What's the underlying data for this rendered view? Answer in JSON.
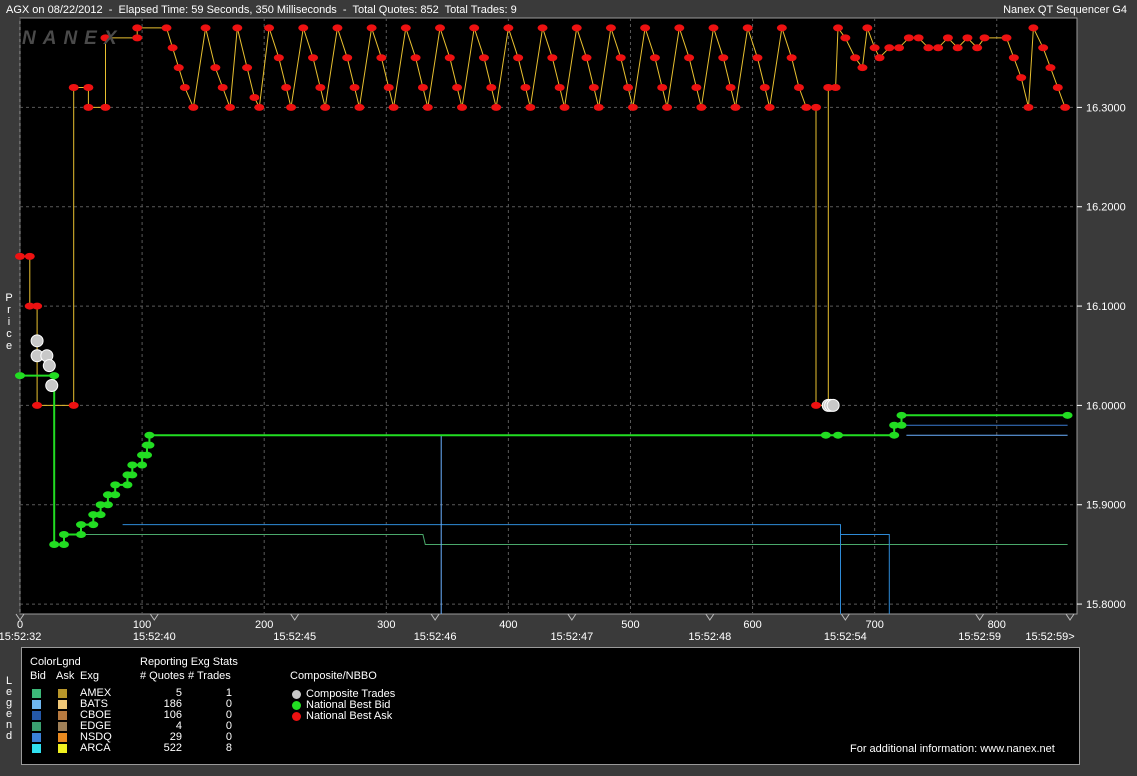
{
  "header": {
    "left_text": "AGX on 08/22/2012  -  Elapsed Time: 59 Seconds, 350 Milliseconds  -  Total Quotes: 852  Total Trades: 9",
    "right_text": "Nanex QT Sequencer G4",
    "watermark": "NANEX"
  },
  "axis": {
    "ylabel_letters": [
      "P",
      "r",
      "i",
      "c",
      "e"
    ],
    "legend_letters": [
      "L",
      "e",
      "g",
      "e",
      "n",
      "d"
    ]
  },
  "chart_data": {
    "type": "line",
    "ylim": [
      15.79,
      16.39
    ],
    "xlim": [
      0,
      860
    ],
    "y_ticks": [
      "15.8000",
      "15.9000",
      "16.0000",
      "16.1000",
      "16.2000",
      "16.3000"
    ],
    "x_ticks": [
      "0",
      "100",
      "200",
      "300",
      "400",
      "500",
      "600",
      "700",
      "800"
    ],
    "time_labels": [
      {
        "x": 0,
        "label": "15:52:32"
      },
      {
        "x": 110,
        "label": "15:52:40"
      },
      {
        "x": 225,
        "label": "15:52:45"
      },
      {
        "x": 340,
        "label": "15:52:46"
      },
      {
        "x": 452,
        "label": "15:52:47"
      },
      {
        "x": 565,
        "label": "15:52:48"
      },
      {
        "x": 676,
        "label": "15:52:54"
      },
      {
        "x": 786,
        "label": "15:52:59"
      },
      {
        "x": 860,
        "label": "15:52:59>"
      }
    ],
    "composite_trades": [
      {
        "x": 14,
        "y": 16.065
      },
      {
        "x": 14,
        "y": 16.05
      },
      {
        "x": 22,
        "y": 16.05
      },
      {
        "x": 24,
        "y": 16.04
      },
      {
        "x": 26,
        "y": 16.02
      },
      {
        "x": 662,
        "y": 16.0
      },
      {
        "x": 664,
        "y": 16.0
      },
      {
        "x": 666,
        "y": 16.0
      }
    ],
    "nbbo_bid": [
      {
        "x": 0,
        "y": 16.03
      },
      {
        "x": 28,
        "y": 16.03
      },
      {
        "x": 28,
        "y": 15.86
      },
      {
        "x": 36,
        "y": 15.86
      },
      {
        "x": 36,
        "y": 15.87
      },
      {
        "x": 50,
        "y": 15.87
      },
      {
        "x": 50,
        "y": 15.88
      },
      {
        "x": 60,
        "y": 15.88
      },
      {
        "x": 60,
        "y": 15.89
      },
      {
        "x": 66,
        "y": 15.89
      },
      {
        "x": 66,
        "y": 15.9
      },
      {
        "x": 72,
        "y": 15.9
      },
      {
        "x": 72,
        "y": 15.91
      },
      {
        "x": 78,
        "y": 15.91
      },
      {
        "x": 78,
        "y": 15.92
      },
      {
        "x": 88,
        "y": 15.92
      },
      {
        "x": 88,
        "y": 15.93
      },
      {
        "x": 92,
        "y": 15.93
      },
      {
        "x": 92,
        "y": 15.94
      },
      {
        "x": 100,
        "y": 15.94
      },
      {
        "x": 100,
        "y": 15.95
      },
      {
        "x": 104,
        "y": 15.95
      },
      {
        "x": 104,
        "y": 15.96
      },
      {
        "x": 106,
        "y": 15.96
      },
      {
        "x": 106,
        "y": 15.97
      },
      {
        "x": 660,
        "y": 15.97
      },
      {
        "x": 670,
        "y": 15.97
      },
      {
        "x": 716,
        "y": 15.97
      },
      {
        "x": 716,
        "y": 15.98
      },
      {
        "x": 722,
        "y": 15.98
      },
      {
        "x": 722,
        "y": 15.99
      },
      {
        "x": 858,
        "y": 15.99
      }
    ],
    "nbbo_ask": [
      {
        "x": 0,
        "y": 16.15
      },
      {
        "x": 8,
        "y": 16.15
      },
      {
        "x": 8,
        "y": 16.1
      },
      {
        "x": 14,
        "y": 16.1
      },
      {
        "x": 14,
        "y": 16.0
      },
      {
        "x": 44,
        "y": 16.0
      },
      {
        "x": 44,
        "y": 16.32
      },
      {
        "x": 56,
        "y": 16.32
      },
      {
        "x": 56,
        "y": 16.3
      },
      {
        "x": 70,
        "y": 16.3
      },
      {
        "x": 70,
        "y": 16.37
      },
      {
        "x": 96,
        "y": 16.37
      },
      {
        "x": 96,
        "y": 16.38
      },
      {
        "x": 120,
        "y": 16.38
      },
      {
        "x": 125,
        "y": 16.36
      },
      {
        "x": 130,
        "y": 16.34
      },
      {
        "x": 135,
        "y": 16.32
      },
      {
        "x": 142,
        "y": 16.3
      },
      {
        "x": 152,
        "y": 16.38
      },
      {
        "x": 160,
        "y": 16.34
      },
      {
        "x": 166,
        "y": 16.32
      },
      {
        "x": 172,
        "y": 16.3
      },
      {
        "x": 178,
        "y": 16.38
      },
      {
        "x": 186,
        "y": 16.34
      },
      {
        "x": 192,
        "y": 16.31
      },
      {
        "x": 196,
        "y": 16.3
      },
      {
        "x": 204,
        "y": 16.38
      },
      {
        "x": 212,
        "y": 16.35
      },
      {
        "x": 218,
        "y": 16.32
      },
      {
        "x": 222,
        "y": 16.3
      },
      {
        "x": 232,
        "y": 16.38
      },
      {
        "x": 240,
        "y": 16.35
      },
      {
        "x": 246,
        "y": 16.32
      },
      {
        "x": 250,
        "y": 16.3
      },
      {
        "x": 260,
        "y": 16.38
      },
      {
        "x": 268,
        "y": 16.35
      },
      {
        "x": 274,
        "y": 16.32
      },
      {
        "x": 278,
        "y": 16.3
      },
      {
        "x": 288,
        "y": 16.38
      },
      {
        "x": 296,
        "y": 16.35
      },
      {
        "x": 302,
        "y": 16.32
      },
      {
        "x": 306,
        "y": 16.3
      },
      {
        "x": 316,
        "y": 16.38
      },
      {
        "x": 324,
        "y": 16.35
      },
      {
        "x": 330,
        "y": 16.32
      },
      {
        "x": 334,
        "y": 16.3
      },
      {
        "x": 344,
        "y": 16.38
      },
      {
        "x": 352,
        "y": 16.35
      },
      {
        "x": 358,
        "y": 16.32
      },
      {
        "x": 362,
        "y": 16.3
      },
      {
        "x": 372,
        "y": 16.38
      },
      {
        "x": 380,
        "y": 16.35
      },
      {
        "x": 386,
        "y": 16.32
      },
      {
        "x": 390,
        "y": 16.3
      },
      {
        "x": 400,
        "y": 16.38
      },
      {
        "x": 408,
        "y": 16.35
      },
      {
        "x": 414,
        "y": 16.32
      },
      {
        "x": 418,
        "y": 16.3
      },
      {
        "x": 428,
        "y": 16.38
      },
      {
        "x": 436,
        "y": 16.35
      },
      {
        "x": 442,
        "y": 16.32
      },
      {
        "x": 446,
        "y": 16.3
      },
      {
        "x": 456,
        "y": 16.38
      },
      {
        "x": 464,
        "y": 16.35
      },
      {
        "x": 470,
        "y": 16.32
      },
      {
        "x": 474,
        "y": 16.3
      },
      {
        "x": 484,
        "y": 16.38
      },
      {
        "x": 492,
        "y": 16.35
      },
      {
        "x": 498,
        "y": 16.32
      },
      {
        "x": 502,
        "y": 16.3
      },
      {
        "x": 512,
        "y": 16.38
      },
      {
        "x": 520,
        "y": 16.35
      },
      {
        "x": 526,
        "y": 16.32
      },
      {
        "x": 530,
        "y": 16.3
      },
      {
        "x": 540,
        "y": 16.38
      },
      {
        "x": 548,
        "y": 16.35
      },
      {
        "x": 554,
        "y": 16.32
      },
      {
        "x": 558,
        "y": 16.3
      },
      {
        "x": 568,
        "y": 16.38
      },
      {
        "x": 576,
        "y": 16.35
      },
      {
        "x": 582,
        "y": 16.32
      },
      {
        "x": 586,
        "y": 16.3
      },
      {
        "x": 596,
        "y": 16.38
      },
      {
        "x": 604,
        "y": 16.35
      },
      {
        "x": 610,
        "y": 16.32
      },
      {
        "x": 614,
        "y": 16.3
      },
      {
        "x": 624,
        "y": 16.38
      },
      {
        "x": 632,
        "y": 16.35
      },
      {
        "x": 638,
        "y": 16.32
      },
      {
        "x": 644,
        "y": 16.3
      },
      {
        "x": 652,
        "y": 16.3
      },
      {
        "x": 652,
        "y": 16.0
      },
      {
        "x": 662,
        "y": 16.0
      },
      {
        "x": 662,
        "y": 16.32
      },
      {
        "x": 668,
        "y": 16.32
      },
      {
        "x": 670,
        "y": 16.38
      },
      {
        "x": 676,
        "y": 16.37
      },
      {
        "x": 684,
        "y": 16.35
      },
      {
        "x": 690,
        "y": 16.34
      },
      {
        "x": 694,
        "y": 16.38
      },
      {
        "x": 700,
        "y": 16.36
      },
      {
        "x": 704,
        "y": 16.35
      },
      {
        "x": 712,
        "y": 16.36
      },
      {
        "x": 720,
        "y": 16.36
      },
      {
        "x": 728,
        "y": 16.37
      },
      {
        "x": 736,
        "y": 16.37
      },
      {
        "x": 744,
        "y": 16.36
      },
      {
        "x": 752,
        "y": 16.36
      },
      {
        "x": 760,
        "y": 16.37
      },
      {
        "x": 768,
        "y": 16.36
      },
      {
        "x": 776,
        "y": 16.37
      },
      {
        "x": 784,
        "y": 16.36
      },
      {
        "x": 790,
        "y": 16.37
      },
      {
        "x": 808,
        "y": 16.37
      },
      {
        "x": 814,
        "y": 16.35
      },
      {
        "x": 820,
        "y": 16.33
      },
      {
        "x": 826,
        "y": 16.3
      },
      {
        "x": 830,
        "y": 16.38
      },
      {
        "x": 838,
        "y": 16.36
      },
      {
        "x": 844,
        "y": 16.34
      },
      {
        "x": 850,
        "y": 16.32
      },
      {
        "x": 856,
        "y": 16.3
      }
    ],
    "exchange_lines": [
      {
        "exchange": "AMEX",
        "side": "bid",
        "color": "#4aa86a",
        "points": [
          {
            "x": 40,
            "y": 15.87
          },
          {
            "x": 330,
            "y": 15.87
          },
          {
            "x": 332,
            "y": 15.86
          },
          {
            "x": 858,
            "y": 15.86
          }
        ]
      },
      {
        "exchange": "BATS",
        "side": "bid",
        "color": "#2e8ad6",
        "points": [
          {
            "x": 84,
            "y": 15.88
          },
          {
            "x": 672,
            "y": 15.88
          },
          {
            "x": 672,
            "y": 15.79
          }
        ]
      },
      {
        "exchange": "BATS",
        "side": "bid",
        "color": "#2e8ad6",
        "points": [
          {
            "x": 672,
            "y": 15.87
          },
          {
            "x": 712,
            "y": 15.87
          },
          {
            "x": 712,
            "y": 15.79
          }
        ]
      },
      {
        "exchange": "CBOE",
        "side": "bid",
        "color": "#3a7ad0",
        "points": [
          {
            "x": 722,
            "y": 15.98
          },
          {
            "x": 858,
            "y": 15.98
          }
        ]
      },
      {
        "exchange": "ARCA",
        "side": "bid",
        "color": "#6ab0ff",
        "points": [
          {
            "x": 110,
            "y": 15.97
          },
          {
            "x": 345,
            "y": 15.97
          },
          {
            "x": 345,
            "y": 15.79
          }
        ]
      },
      {
        "exchange": "ARCA",
        "side": "bid",
        "color": "#6ab0ff",
        "points": [
          {
            "x": 726,
            "y": 15.97
          },
          {
            "x": 858,
            "y": 15.97
          }
        ]
      }
    ]
  },
  "legend": {
    "title_colorlgnd": "ColorLgnd",
    "col_bid": "Bid",
    "col_ask": "Ask",
    "col_exg": "Exg",
    "title_stats": "Reporting Exg Stats",
    "col_quotes": "# Quotes",
    "col_trades": "# Trades",
    "title_composite": "Composite/NBBO",
    "rows": [
      {
        "exg": "AMEX",
        "quotes": "5",
        "trades": "1",
        "bid_color": "#3cb878",
        "ask_color": "#b8962a"
      },
      {
        "exg": "BATS",
        "quotes": "186",
        "trades": "0",
        "bid_color": "#6fb7f0",
        "ask_color": "#f0c878"
      },
      {
        "exg": "CBOE",
        "quotes": "106",
        "trades": "0",
        "bid_color": "#2458a8",
        "ask_color": "#b87a40"
      },
      {
        "exg": "EDGE",
        "quotes": "4",
        "trades": "0",
        "bid_color": "#3aa070",
        "ask_color": "#a08058"
      },
      {
        "exg": "NSDQ",
        "quotes": "29",
        "trades": "0",
        "bid_color": "#3a82d8",
        "ask_color": "#e88a20"
      },
      {
        "exg": "ARCA",
        "quotes": "522",
        "trades": "8",
        "bid_color": "#30e0f0",
        "ask_color": "#f0f020"
      }
    ],
    "composite_items": [
      {
        "label": "Composite Trades",
        "color": "#c8c8c8"
      },
      {
        "label": "National Best Bid",
        "color": "#22dd22"
      },
      {
        "label": "National Best Ask",
        "color": "#ee1111"
      }
    ],
    "footer": "For additional information: www.nanex.net"
  }
}
